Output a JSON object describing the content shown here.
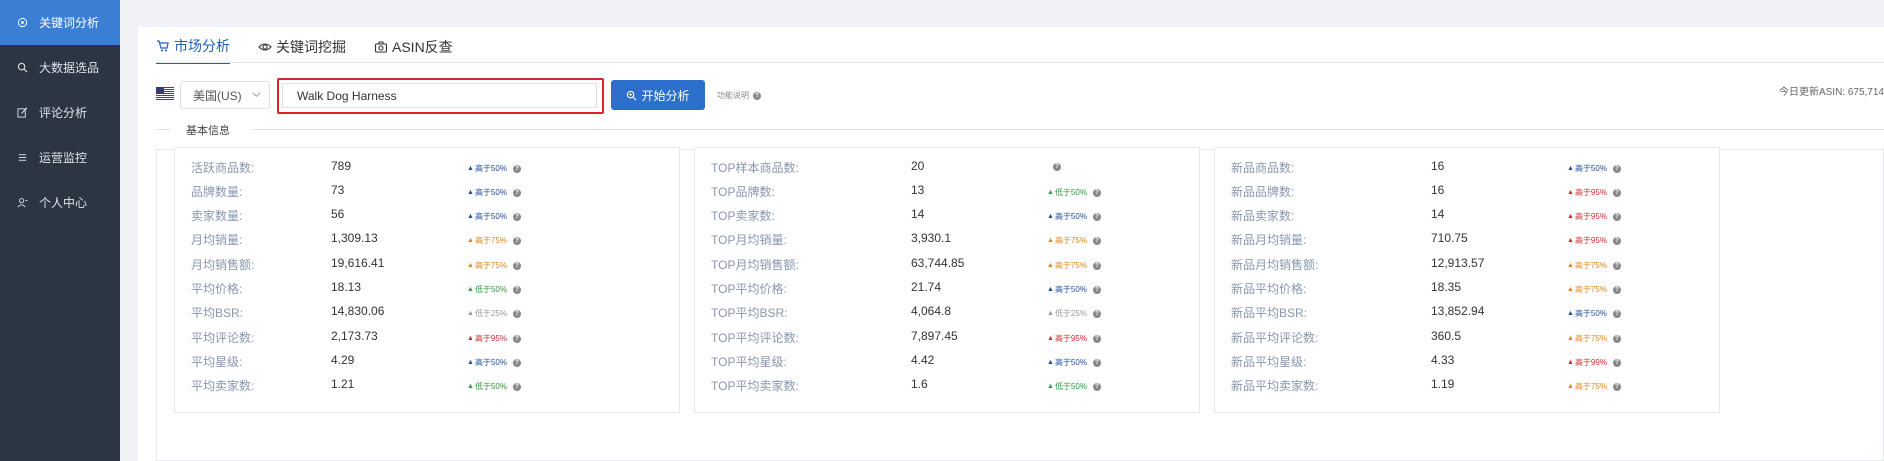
{
  "sidebar": {
    "items": [
      {
        "label": "关键词分析",
        "icon": "target-icon",
        "active": true
      },
      {
        "label": "大数据选品",
        "icon": "search-icon",
        "active": false
      },
      {
        "label": "评论分析",
        "icon": "edit-icon",
        "active": false
      },
      {
        "label": "运营监控",
        "icon": "list-icon",
        "active": false
      },
      {
        "label": "个人中心",
        "icon": "user-icon",
        "active": false
      }
    ]
  },
  "tabs": [
    {
      "label": "市场分析",
      "icon": "cart-icon",
      "active": true
    },
    {
      "label": "关键词挖掘",
      "icon": "eye-icon",
      "active": false
    },
    {
      "label": "ASIN反查",
      "icon": "camera-icon",
      "active": false
    }
  ],
  "search": {
    "country": "美国(US)",
    "value": "Walk Dog Harness",
    "button_label": "开始分析",
    "help_label": "功能说明",
    "today_update": "今日更新ASIN: 675,714"
  },
  "section_title": "基本信息",
  "colors": {
    "accent": "#2c6fcc",
    "sidebar_bg": "#2c3542",
    "highlight_border": "#d9242c",
    "badge_blue": "#2250a0",
    "badge_orange": "#e3841c",
    "badge_green": "#2f9a3b",
    "badge_red": "#cc2f2f",
    "badge_gray": "#999999"
  },
  "cards": [
    {
      "rows": [
        {
          "label": "活跃商品数:",
          "value": "789",
          "badge": "高于50%",
          "tone": "blue"
        },
        {
          "label": "品牌数量:",
          "value": "73",
          "badge": "高于50%",
          "tone": "blue"
        },
        {
          "label": "卖家数量:",
          "value": "56",
          "badge": "高于50%",
          "tone": "blue"
        },
        {
          "label": "月均销量:",
          "value": "1,309.13",
          "badge": "高于75%",
          "tone": "orange"
        },
        {
          "label": "月均销售额:",
          "value": "19,616.41",
          "badge": "高于75%",
          "tone": "orange"
        },
        {
          "label": "平均价格:",
          "value": "18.13",
          "badge": "低于50%",
          "tone": "green"
        },
        {
          "label": "平均BSR:",
          "value": "14,830.06",
          "badge": "低于25%",
          "tone": "gray"
        },
        {
          "label": "平均评论数:",
          "value": "2,173.73",
          "badge": "高于95%",
          "tone": "red"
        },
        {
          "label": "平均星级:",
          "value": "4.29",
          "badge": "高于50%",
          "tone": "blue"
        },
        {
          "label": "平均卖家数:",
          "value": "1.21",
          "badge": "低于50%",
          "tone": "green"
        }
      ]
    },
    {
      "rows": [
        {
          "label": "TOP样本商品数:",
          "value": "20",
          "badge": "",
          "tone": "none"
        },
        {
          "label": "TOP品牌数:",
          "value": "13",
          "badge": "低于50%",
          "tone": "green"
        },
        {
          "label": "TOP卖家数:",
          "value": "14",
          "badge": "高于50%",
          "tone": "blue"
        },
        {
          "label": "TOP月均销量:",
          "value": "3,930.1",
          "badge": "高于75%",
          "tone": "orange"
        },
        {
          "label": "TOP月均销售额:",
          "value": "63,744.85",
          "badge": "高于75%",
          "tone": "orange"
        },
        {
          "label": "TOP平均价格:",
          "value": "21.74",
          "badge": "高于50%",
          "tone": "blue"
        },
        {
          "label": "TOP平均BSR:",
          "value": "4,064.8",
          "badge": "低于25%",
          "tone": "gray"
        },
        {
          "label": "TOP平均评论数:",
          "value": "7,897.45",
          "badge": "高于95%",
          "tone": "red"
        },
        {
          "label": "TOP平均星级:",
          "value": "4.42",
          "badge": "高于50%",
          "tone": "blue"
        },
        {
          "label": "TOP平均卖家数:",
          "value": "1.6",
          "badge": "低于50%",
          "tone": "green"
        }
      ]
    },
    {
      "rows": [
        {
          "label": "新品商品数:",
          "value": "16",
          "badge": "高于50%",
          "tone": "blue"
        },
        {
          "label": "新品品牌数:",
          "value": "16",
          "badge": "高于95%",
          "tone": "red"
        },
        {
          "label": "新品卖家数:",
          "value": "14",
          "badge": "高于95%",
          "tone": "red"
        },
        {
          "label": "新品月均销量:",
          "value": "710.75",
          "badge": "高于95%",
          "tone": "red"
        },
        {
          "label": "新品月均销售额:",
          "value": "12,913.57",
          "badge": "高于75%",
          "tone": "orange"
        },
        {
          "label": "新品平均价格:",
          "value": "18.35",
          "badge": "高于75%",
          "tone": "orange"
        },
        {
          "label": "新品平均BSR:",
          "value": "13,852.94",
          "badge": "高于50%",
          "tone": "blue"
        },
        {
          "label": "新品平均评论数:",
          "value": "360.5",
          "badge": "高于75%",
          "tone": "orange"
        },
        {
          "label": "新品平均星级:",
          "value": "4.33",
          "badge": "高于99%",
          "tone": "red"
        },
        {
          "label": "新品平均卖家数:",
          "value": "1.19",
          "badge": "高于75%",
          "tone": "orange"
        }
      ]
    }
  ]
}
